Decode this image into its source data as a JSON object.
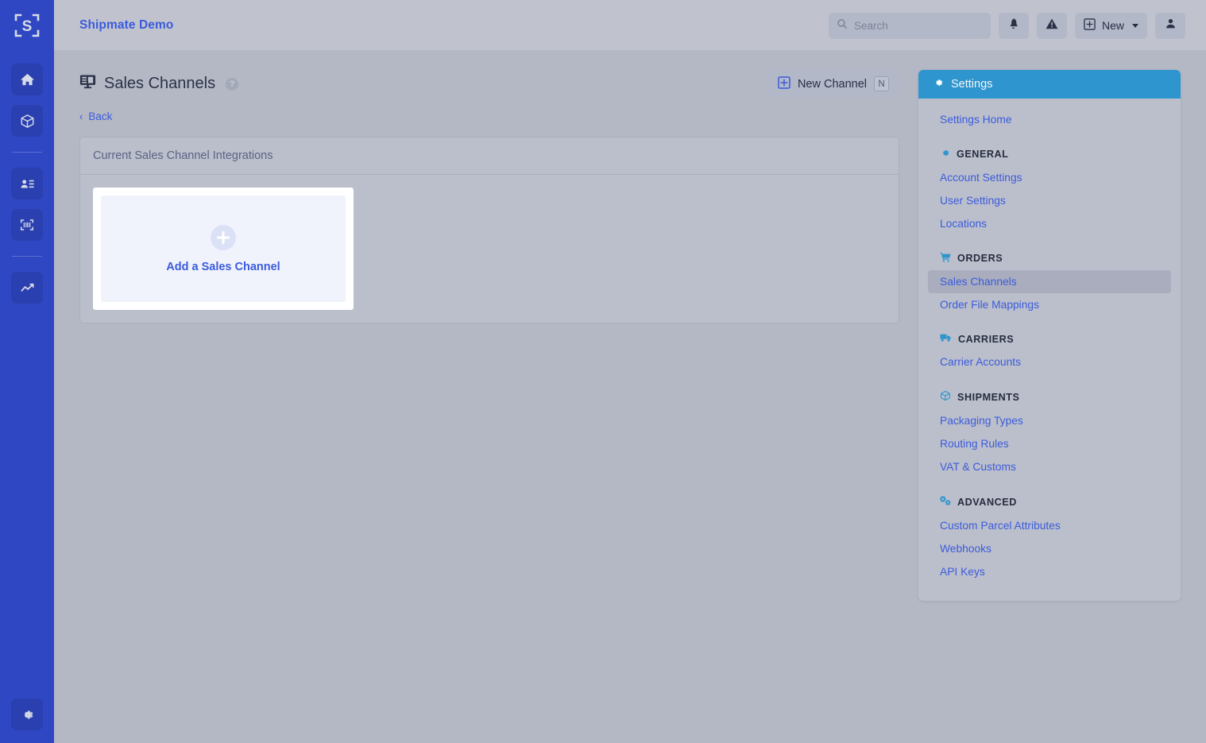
{
  "app": {
    "brand": "Shipmate Demo",
    "logo_icon": "shipmate-s-logo"
  },
  "rail": {
    "items": [
      {
        "name": "home",
        "icon": "home-icon"
      },
      {
        "name": "shipments",
        "icon": "box-icon"
      },
      {
        "name": "contacts",
        "icon": "address-card-icon"
      },
      {
        "name": "scan",
        "icon": "barcode-scan-icon"
      },
      {
        "name": "reports",
        "icon": "chart-line-icon"
      }
    ],
    "bottom": {
      "name": "settings",
      "icon": "gear-icon"
    }
  },
  "topbar": {
    "search": {
      "placeholder": "Search",
      "value": "",
      "icon": "search-icon"
    },
    "notifications_icon": "bell-icon",
    "alerts_icon": "warning-triangle-icon",
    "new_label": "New",
    "new_icon": "plus-square-icon",
    "account_icon": "user-icon"
  },
  "page": {
    "title": "Sales Channels",
    "title_icon": "desktop-display-icon",
    "help_icon": "question-mark-icon",
    "help_glyph": "?",
    "back_label": "Back",
    "back_chevron": "‹",
    "new_channel_label": "New Channel",
    "new_channel_icon": "plus-square-icon",
    "new_channel_shortcut": "N"
  },
  "panel": {
    "header": "Current Sales Channel Integrations",
    "add_card": {
      "label": "Add a Sales Channel",
      "icon": "plus-circle-icon"
    }
  },
  "settings": {
    "header": "Settings",
    "header_icon": "gear-icon",
    "home_label": "Settings Home",
    "sections": [
      {
        "label": "GENERAL",
        "icon": "gear-icon",
        "items": [
          {
            "label": "Account Settings",
            "active": false
          },
          {
            "label": "User Settings",
            "active": false
          },
          {
            "label": "Locations",
            "active": false
          }
        ]
      },
      {
        "label": "ORDERS",
        "icon": "shopping-cart-icon",
        "items": [
          {
            "label": "Sales Channels",
            "active": true
          },
          {
            "label": "Order File Mappings",
            "active": false
          }
        ]
      },
      {
        "label": "CARRIERS",
        "icon": "truck-icon",
        "items": [
          {
            "label": "Carrier Accounts",
            "active": false
          }
        ]
      },
      {
        "label": "SHIPMENTS",
        "icon": "box-icon",
        "items": [
          {
            "label": "Packaging Types",
            "active": false
          },
          {
            "label": "Routing Rules",
            "active": false
          },
          {
            "label": "VAT & Customs",
            "active": false
          }
        ]
      },
      {
        "label": "ADVANCED",
        "icon": "cogs-icon",
        "items": [
          {
            "label": "Custom Parcel Attributes",
            "active": false
          },
          {
            "label": "Webhooks",
            "active": false
          },
          {
            "label": "API Keys",
            "active": false
          }
        ]
      }
    ]
  },
  "colors": {
    "rail_blue": "#2f47c2",
    "page_background": "#b4b7c4",
    "link_blue": "#3b5bdb",
    "settings_header_blue": "#2e95ce",
    "section_icon_blue": "#2e95ce",
    "card_inner": "#f0f3fc"
  }
}
